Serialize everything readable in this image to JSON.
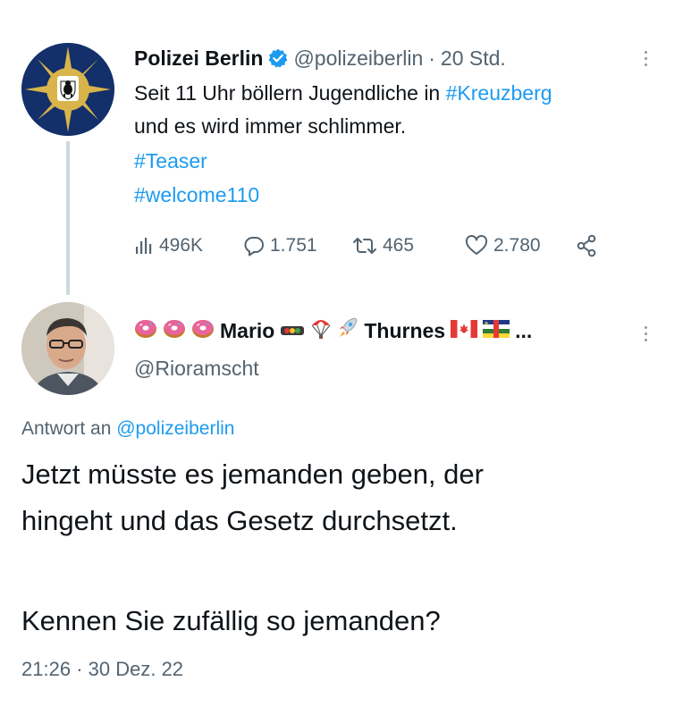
{
  "original_tweet": {
    "display_name": "Polizei Berlin",
    "handle": "@polizeiberlin",
    "separator": "·",
    "time_ago": "20 Std.",
    "text_line1_prefix": "Seit 11 Uhr böllern Jugendliche in ",
    "text_line1_hashtag": "#Kreuzberg",
    "text_line2": "und es wird immer schlimmer.",
    "hashtag_2": "#Teaser",
    "hashtag_3": "#welcome110",
    "stats": {
      "views": "496K",
      "replies": "1.751",
      "retweets": "465",
      "likes": "2.780"
    },
    "icons": {
      "avatar": "police-star-badge-icon",
      "verified": "verified-badge-icon",
      "more": "more-vertical-icon",
      "views": "analytics-icon",
      "reply": "reply-icon",
      "retweet": "retweet-icon",
      "like": "heart-icon",
      "share": "share-icon"
    }
  },
  "reply_tweet": {
    "display_name_text_1": "Mario",
    "display_name_text_2": "Thurnes",
    "display_name_ellipsis": "...",
    "name_emojis_prefix": [
      "donut",
      "donut",
      "donut"
    ],
    "name_emojis_middle": [
      "traffic-light",
      "parachute",
      "rocket"
    ],
    "name_emojis_suffix": [
      "canada-flag",
      "central-african-republic-flag"
    ],
    "handle": "@Rioramscht",
    "reply_label": "Antwort an ",
    "reply_target": "@polizeiberlin",
    "body_line1": "Jetzt müsste es jemanden geben, der",
    "body_line2": "hingeht und das Gesetz durchsetzt.",
    "body_line3": "Kennen Sie zufällig so jemanden?",
    "time": "21:26",
    "separator": "·",
    "date": "30 Dez. 22"
  },
  "colors": {
    "link": "#1d9bf0",
    "muted": "#536471",
    "verified": "#1d9bf0",
    "thread_line": "#cfd9de",
    "badge_blue": "#13306a",
    "badge_gold": "#d9b44a"
  }
}
